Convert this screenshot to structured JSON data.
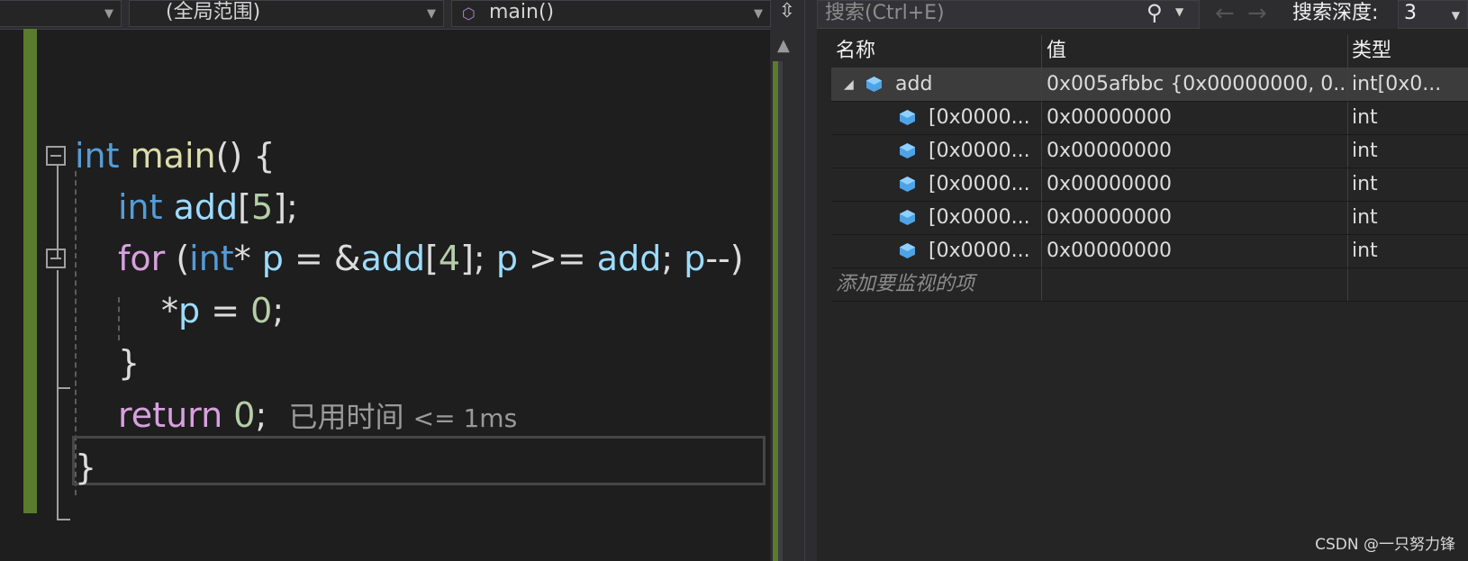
{
  "nav": {
    "project_label": "",
    "scope_label": "(全局范围)",
    "function_label": "main()"
  },
  "code": {
    "line1": {
      "kw": "int",
      "fn": "main",
      "rest": "() {"
    },
    "line2": {
      "kw": "int",
      "var": "add",
      "open": "[",
      "num": "5",
      "close": "];"
    },
    "line3": {
      "kw": "for",
      "p1": " (",
      "kw2": "int",
      "p2": "* ",
      "v1": "p",
      "p3": " = &",
      "v2": "add",
      "p4": "[",
      "n1": "4",
      "p5": "]; ",
      "v3": "p",
      "p6": " >= ",
      "v4": "add",
      "p7": "; ",
      "v5": "p",
      "p8": "--)"
    },
    "line4": {
      "p1": "*",
      "var": "p",
      "p2": " = ",
      "num": "0",
      "p3": ";"
    },
    "line5": {
      "text": "}"
    },
    "line6": {
      "kw": "return",
      "sp": " ",
      "num": "0",
      "semi": ";",
      "elapsed_label": "已用时间",
      "elapsed_value": "<= 1ms"
    },
    "line7": {
      "text": "}"
    }
  },
  "watch": {
    "search_placeholder": "搜索(Ctrl+E)",
    "depth_label": "搜索深度:",
    "depth_value": "3",
    "columns": {
      "name": "名称",
      "value": "值",
      "type": "类型"
    },
    "root": {
      "name": "add",
      "value": "0x005afbbc {0x00000000, 0...",
      "type": "int[0x0..."
    },
    "children": [
      {
        "name": "[0x0000...",
        "value": "0x00000000",
        "type": "int"
      },
      {
        "name": "[0x0000...",
        "value": "0x00000000",
        "type": "int"
      },
      {
        "name": "[0x0000...",
        "value": "0x00000000",
        "type": "int"
      },
      {
        "name": "[0x0000...",
        "value": "0x00000000",
        "type": "int"
      },
      {
        "name": "[0x0000...",
        "value": "0x00000000",
        "type": "int"
      }
    ],
    "add_watch_placeholder": "添加要监视的项"
  },
  "watermark": "CSDN @一只努力锋",
  "colors": {
    "keyword": "#569cd6",
    "control": "#d8a0df",
    "function": "#dcdcaa",
    "variable": "#9cdcfe",
    "number": "#b5cea8",
    "change_bar": "#5a7b2e"
  },
  "icons": [
    "cube-icon",
    "split-icon",
    "scroll-up-icon",
    "search-icon",
    "back-arrow-icon",
    "forward-arrow-icon",
    "expander-icon",
    "variable-icon"
  ]
}
